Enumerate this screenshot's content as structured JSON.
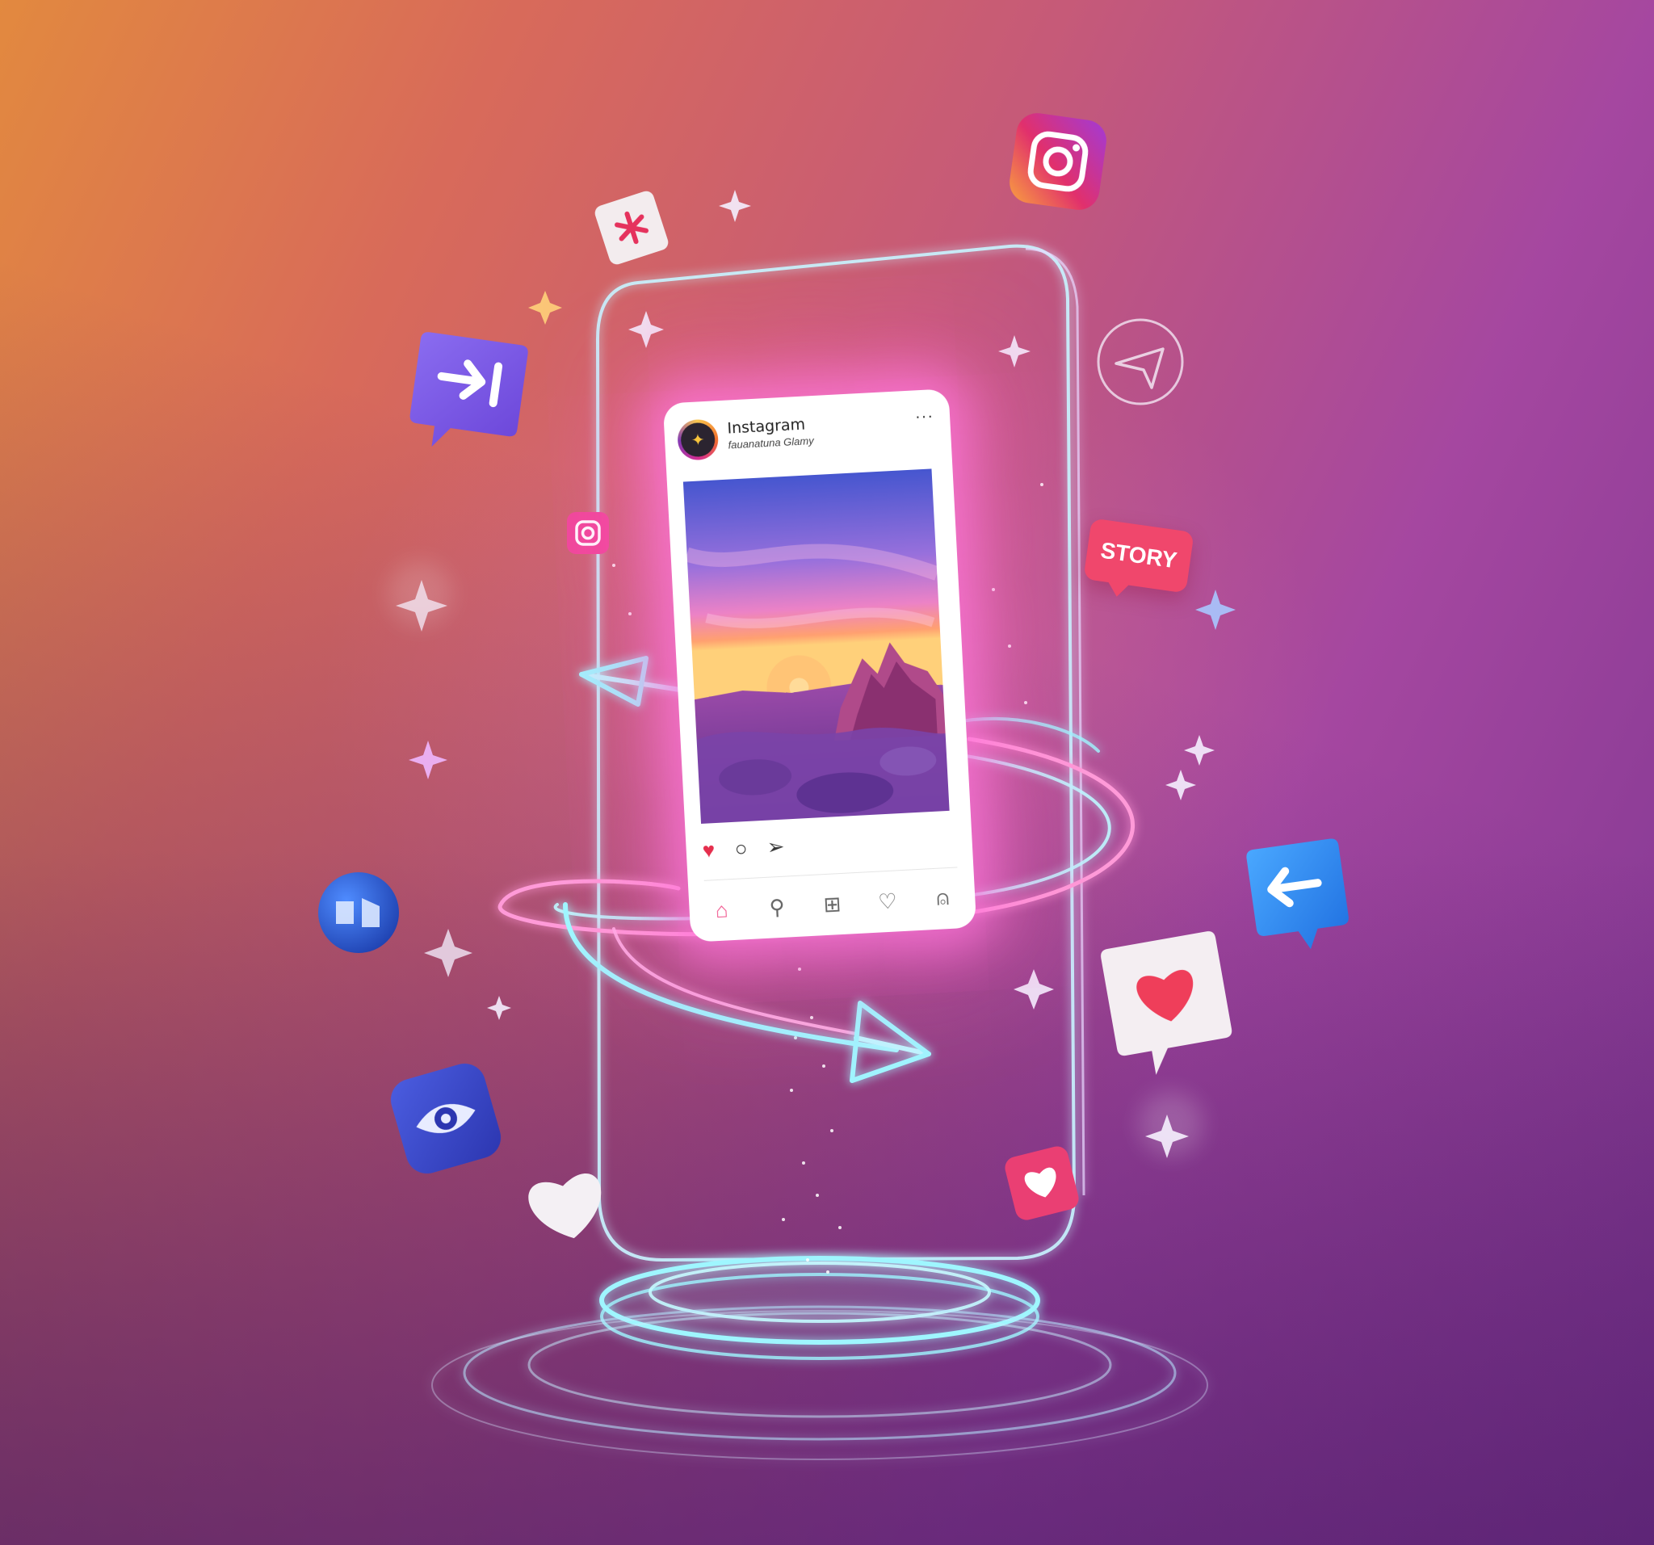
{
  "post": {
    "account_name": "Instagram",
    "account_subtitle": "fauanatuna Glamy",
    "more_icon": "more-dots-icon",
    "actions": [
      "heart-icon",
      "comment-icon",
      "share-icon"
    ],
    "nav": [
      "home-icon",
      "search-icon",
      "add-post-icon",
      "activity-heart-icon",
      "profile-icon"
    ]
  },
  "badges": {
    "story_label": "STORY"
  },
  "colors": {
    "accent_pink": "#f0476c",
    "glow_cyan": "#8ff0ff",
    "brand_purple": "#7b5ce0"
  }
}
